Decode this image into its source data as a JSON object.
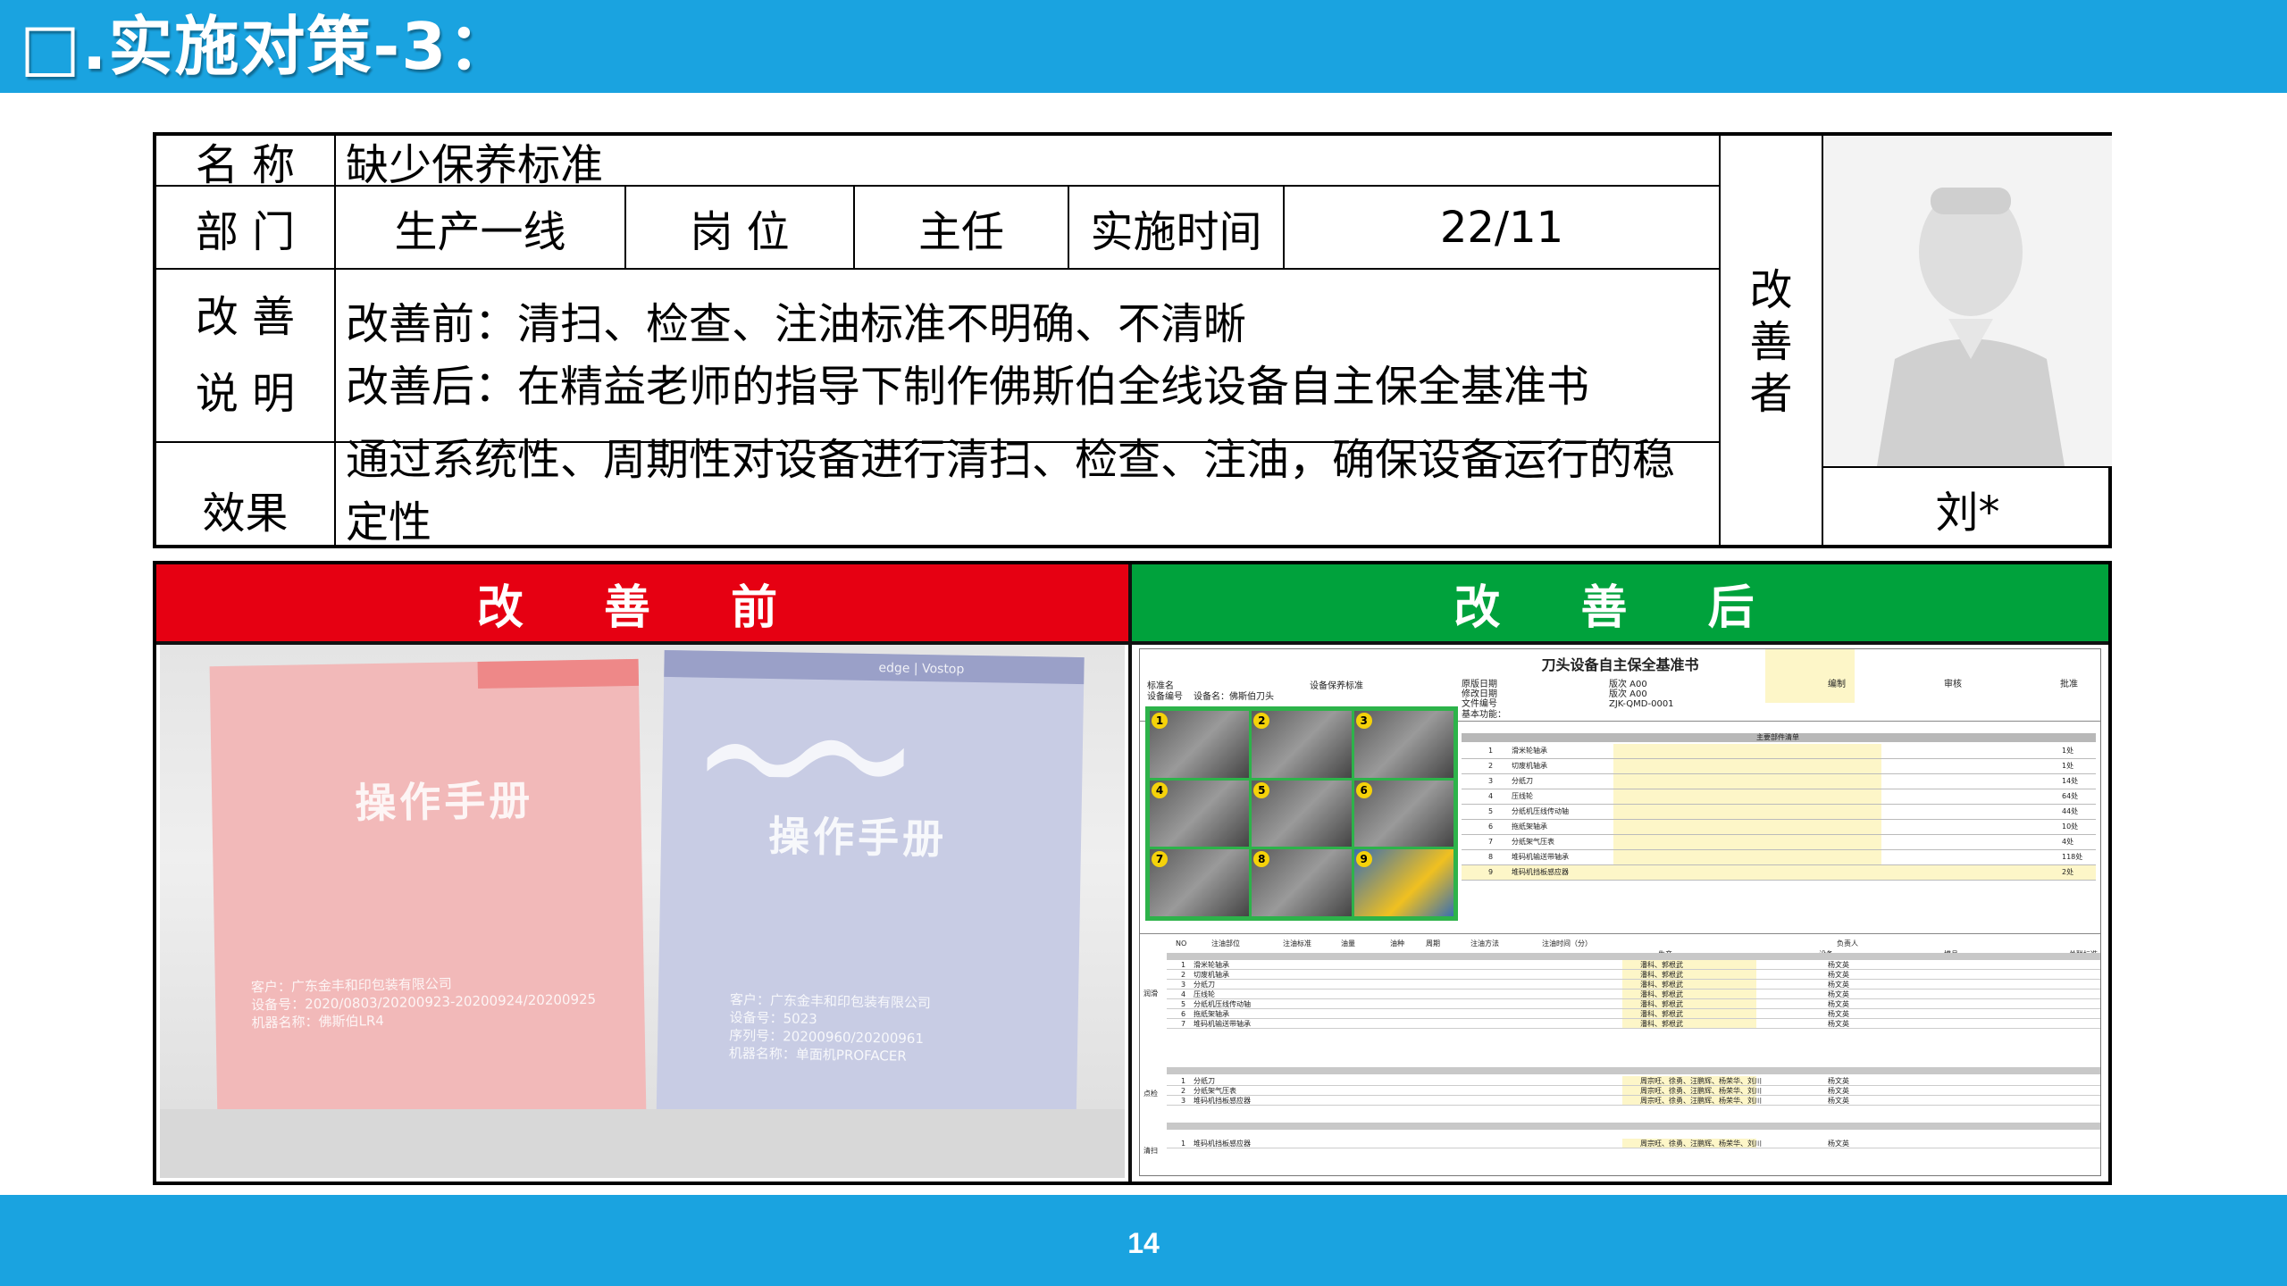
{
  "header": {
    "title": "□.实施对策-3："
  },
  "info": {
    "name_label": "名 称",
    "name_value": "缺少保养标准",
    "dept_label": "部 门",
    "dept_value": "生产一线",
    "post_label": "岗 位",
    "post_value": "主任",
    "time_label": "实施时间",
    "time_value": "22/11",
    "desc_label_1": "改 善",
    "desc_label_2": "说 明",
    "desc_before": "改善前：清扫、检查、注油标准不明确、不清晰",
    "desc_after": "改善后：在精益老师的指导下制作佛斯伯全线设备自主保全基准书",
    "effect_label": "效果",
    "effect_value": "通过系统性、周期性对设备进行清扫、检查、注油，确保设备运行的稳定性",
    "improver_label": "改善者",
    "improver_name": "刘*"
  },
  "panels": {
    "before_label": "改 善 前",
    "after_label": "改 善 后"
  },
  "before_photo": {
    "manual_title": "操作手册",
    "red_lines": [
      "客户：广东金丰和印包装有限公司",
      "设备号：2020/0803/20200923-20200924/20200925",
      "机器名称：佛斯伯LR4"
    ],
    "blue_lines": [
      "客户：广东金丰和印包装有限公司",
      "设备号：5023",
      "序列号：20200960/20200961",
      "机器名称：单面机PROFACER"
    ],
    "blue_brand": "edge | Vostop"
  },
  "after_doc": {
    "title": "刀头设备自主保全基准书",
    "hdr_labels": [
      "标准名",
      "设备编号",
      "设备名：佛斯伯刀头",
      "设备保养标准",
      "原版日期",
      "修改日期",
      "文件编号",
      "基本功能："
    ],
    "hdr_values": [
      "版次 A00",
      "版次 A00",
      "ZJK-QMD-0001",
      "编制",
      "审核",
      "批准"
    ],
    "parts_header": "主要部件清单",
    "parts": [
      "滑米轮轴承",
      "切废机轴承",
      "分纸刀",
      "压线轮",
      "分纸机压线传动轴",
      "拖纸架轴承",
      "分纸架气压表",
      "堆码机输送带轴承",
      "堆码机挡板感应器"
    ],
    "parts_qty": [
      "1处",
      "1处",
      "14处",
      "64处",
      "44处",
      "10处",
      "4处",
      "118处",
      "2处"
    ],
    "section_labels": [
      "润滑",
      "点检",
      "清扫"
    ],
    "col_headers": [
      "NO",
      "注油部位",
      "注油标准",
      "油量",
      "油种",
      "周期",
      "注油方法",
      "注油时间（分）",
      "负责人",
      "生产",
      "设备",
      "模具",
      "关联标准"
    ],
    "owner_text": "潘科、郭根武",
    "owner_text2": "周宗旺、徐勇、汪鹏辉、杨荣华、刘川",
    "eq_text": "杨文英"
  },
  "footer": {
    "page_number": "14"
  }
}
